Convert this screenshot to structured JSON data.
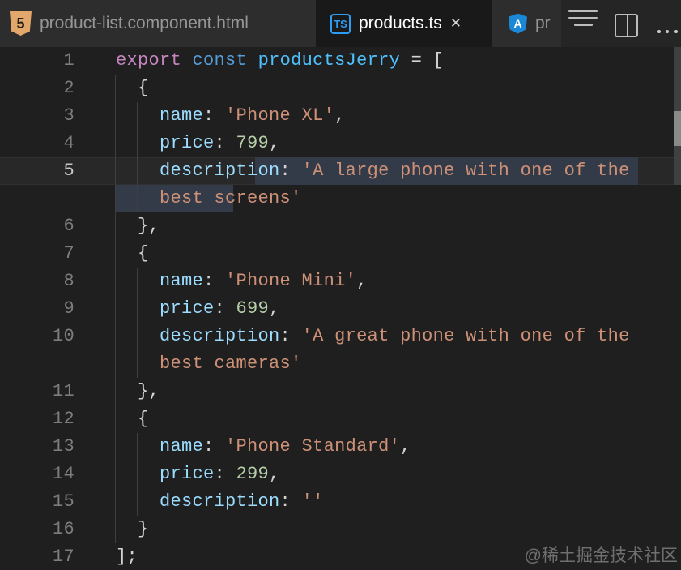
{
  "tabbar": {
    "tabs": [
      {
        "label": "product-list.component.html",
        "icon": "html5-icon",
        "active": false
      },
      {
        "label": "products.ts",
        "icon": "typescript-icon",
        "active": true,
        "close": "✕"
      },
      {
        "label": "pr",
        "icon": "angular-icon",
        "active": false
      }
    ],
    "actions": [
      {
        "icon": "menu-icon"
      },
      {
        "icon": "split-editor-icon"
      },
      {
        "icon": "more-actions-icon"
      }
    ]
  },
  "icons": {
    "html5_glyph": "5",
    "ts_glyph": "TS",
    "angular_glyph": "A"
  },
  "colors": {
    "editor_background": "#1f1f1f",
    "tabbar_background": "#252526",
    "inactive_tab_background": "#2d2d2d",
    "active_tab_background": "#191919",
    "selection_background": "#333b48",
    "syntax": {
      "kw": "#c586c0",
      "kw2": "#569cd6",
      "var": "#4fc1ff",
      "key": "#9cdcfe",
      "str": "#ce9178",
      "num": "#b5cea8",
      "pln": "#d4d4d4"
    }
  },
  "editor": {
    "rows": [
      {
        "num": "1",
        "code": [
          [
            "kw",
            "export"
          ],
          [
            "pln",
            " "
          ],
          [
            "kw2",
            "const"
          ],
          [
            "pln",
            " "
          ],
          [
            "var",
            "productsJerry"
          ],
          [
            "pln",
            " = ["
          ]
        ]
      },
      {
        "num": "2",
        "code": [
          [
            "pln",
            "  {"
          ]
        ]
      },
      {
        "num": "3",
        "code": [
          [
            "pln",
            "    "
          ],
          [
            "key",
            "name"
          ],
          [
            "pln",
            ": "
          ],
          [
            "str",
            "'Phone XL'"
          ],
          [
            "pln",
            ","
          ]
        ]
      },
      {
        "num": "4",
        "code": [
          [
            "pln",
            "    "
          ],
          [
            "key",
            "price"
          ],
          [
            "pln",
            ": "
          ],
          [
            "num",
            "799"
          ],
          [
            "pln",
            ","
          ]
        ]
      },
      {
        "num": "5",
        "current": true,
        "code": [
          [
            "pln",
            "    "
          ],
          [
            "key",
            "description"
          ],
          [
            "pln",
            ": "
          ],
          [
            "str",
            "'A large phone with one of the"
          ]
        ]
      },
      {
        "num": "",
        "code": [
          [
            "pln",
            "    "
          ],
          [
            "str",
            "best screens'"
          ]
        ]
      },
      {
        "num": "6",
        "code": [
          [
            "pln",
            "  },"
          ]
        ]
      },
      {
        "num": "7",
        "code": [
          [
            "pln",
            "  {"
          ]
        ]
      },
      {
        "num": "8",
        "code": [
          [
            "pln",
            "    "
          ],
          [
            "key",
            "name"
          ],
          [
            "pln",
            ": "
          ],
          [
            "str",
            "'Phone Mini'"
          ],
          [
            "pln",
            ","
          ]
        ]
      },
      {
        "num": "9",
        "code": [
          [
            "pln",
            "    "
          ],
          [
            "key",
            "price"
          ],
          [
            "pln",
            ": "
          ],
          [
            "num",
            "699"
          ],
          [
            "pln",
            ","
          ]
        ]
      },
      {
        "num": "10",
        "code": [
          [
            "pln",
            "    "
          ],
          [
            "key",
            "description"
          ],
          [
            "pln",
            ": "
          ],
          [
            "str",
            "'A great phone with one of the"
          ]
        ]
      },
      {
        "num": "",
        "code": [
          [
            "pln",
            "    "
          ],
          [
            "str",
            "best cameras'"
          ]
        ]
      },
      {
        "num": "11",
        "code": [
          [
            "pln",
            "  },"
          ]
        ]
      },
      {
        "num": "12",
        "code": [
          [
            "pln",
            "  {"
          ]
        ]
      },
      {
        "num": "13",
        "code": [
          [
            "pln",
            "    "
          ],
          [
            "key",
            "name"
          ],
          [
            "pln",
            ": "
          ],
          [
            "str",
            "'Phone Standard'"
          ],
          [
            "pln",
            ","
          ]
        ]
      },
      {
        "num": "14",
        "code": [
          [
            "pln",
            "    "
          ],
          [
            "key",
            "price"
          ],
          [
            "pln",
            ": "
          ],
          [
            "num",
            "299"
          ],
          [
            "pln",
            ","
          ]
        ]
      },
      {
        "num": "15",
        "code": [
          [
            "pln",
            "    "
          ],
          [
            "key",
            "description"
          ],
          [
            "pln",
            ": "
          ],
          [
            "str",
            "''"
          ]
        ]
      },
      {
        "num": "16",
        "code": [
          [
            "pln",
            "  }"
          ]
        ]
      },
      {
        "num": "17",
        "code": [
          [
            "pln",
            "];"
          ]
        ]
      }
    ]
  },
  "watermark": "@稀土掘金技术社区"
}
